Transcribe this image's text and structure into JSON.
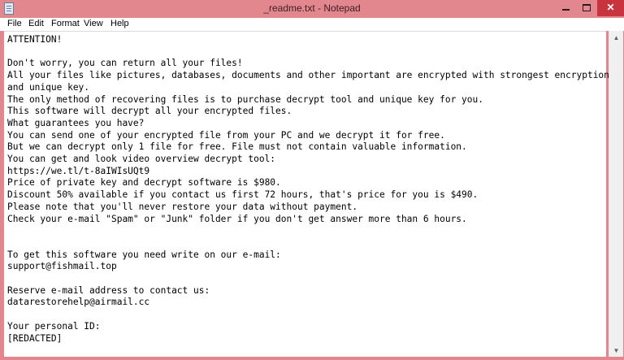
{
  "window": {
    "title": "_readme.txt - Notepad",
    "controls": {
      "minimize": "minimize",
      "maximize": "maximize",
      "close": "✕"
    },
    "accent_color": "#e3878f",
    "close_color": "#c7343d"
  },
  "menu": {
    "file": "File",
    "edit": "Edit",
    "format": "Format",
    "view": "View",
    "help": "Help"
  },
  "document": {
    "lines": [
      "ATTENTION!",
      "",
      "Don't worry, you can return all your files!",
      "All your files like pictures, databases, documents and other important are encrypted with strongest encryption",
      "and unique key.",
      "The only method of recovering files is to purchase decrypt tool and unique key for you.",
      "This software will decrypt all your encrypted files.",
      "What guarantees you have?",
      "You can send one of your encrypted file from your PC and we decrypt it for free.",
      "But we can decrypt only 1 file for free. File must not contain valuable information.",
      "You can get and look video overview decrypt tool:",
      "https://we.tl/t-8aIWIsUQt9",
      "Price of private key and decrypt software is $980.",
      "Discount 50% available if you contact us first 72 hours, that's price for you is $490.",
      "Please note that you'll never restore your data without payment.",
      "Check your e-mail \"Spam\" or \"Junk\" folder if you don't get answer more than 6 hours.",
      "",
      "",
      "To get this software you need write on our e-mail:",
      "support@fishmail.top",
      "",
      "Reserve e-mail address to contact us:",
      "datarestorehelp@airmail.cc",
      "",
      "Your personal ID:",
      "[REDACTED]"
    ]
  },
  "scrollbar": {
    "up_icon": "▲",
    "down_icon": "▼"
  }
}
